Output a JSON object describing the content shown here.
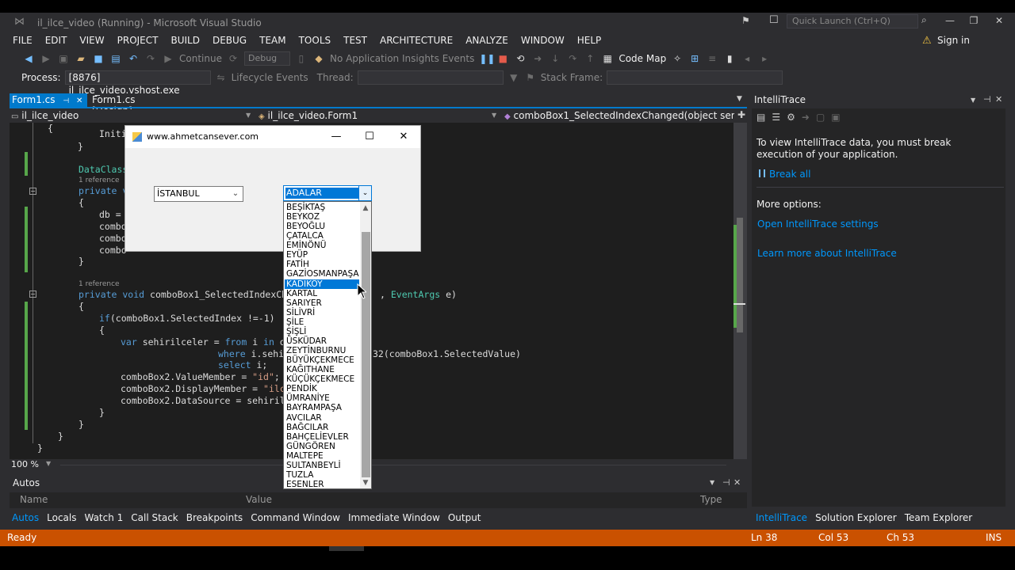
{
  "window": {
    "title": "il_ilce_video (Running) - Microsoft Visual Studio",
    "quick_launch_placeholder": "Quick Launch (Ctrl+Q)",
    "sign_in": "Sign in"
  },
  "menu": [
    "FILE",
    "EDIT",
    "VIEW",
    "PROJECT",
    "BUILD",
    "DEBUG",
    "TEAM",
    "TOOLS",
    "TEST",
    "ARCHITECTURE",
    "ANALYZE",
    "WINDOW",
    "HELP"
  ],
  "toolbar": {
    "continue": "Continue",
    "config": "Debug",
    "insights": "No Application Insights Events",
    "code_map": "Code Map"
  },
  "process_bar": {
    "process_label": "Process:",
    "process_value": "[8876] il_ilce_video.vshost.exe",
    "lifecycle": "Lifecycle Events",
    "thread_label": "Thread:",
    "stack_frame_label": "Stack Frame:"
  },
  "doc_tabs": {
    "active": "Form1.cs",
    "inactive": "Form1.cs [Design]"
  },
  "nav": {
    "project": "il_ilce_video",
    "class": "il_ilce_video.Form1",
    "member": "comboBox1_SelectedIndexChanged(object sender, Even"
  },
  "code": {
    "l1": "Initi",
    "l2": "}",
    "l3": "DataClass",
    "ref1": "1 reference",
    "l4_kw": "private v",
    "l5": "{",
    "l6": "db =",
    "l7": "combo",
    "l8": "combo",
    "l9": "combo",
    "l10": "}",
    "ref2": "1 reference",
    "l11_kw": "private void",
    "l11_rest": " comboBox1_SelectedIndexChar",
    "l11_tail_pre": ", ",
    "l11_tail_typ": "EventArgs",
    "l11_tail_post": " e)",
    "l12": "{",
    "l13_kw": "if",
    "l13_rest": "(comboBox1.SelectedIndex !=-1)",
    "l14": "{",
    "l15_kw": "var",
    "l15_mid": " sehirilceler = ",
    "l15_kw2": "from",
    "l15_mid2": " i ",
    "l15_kw3": "in",
    "l15_end": " db",
    "l16_kw": "where",
    "l16_mid": " i.sehi",
    "l16_end": "32(comboBox1.SelectedValue)",
    "l17_kw": "select",
    "l17_end": " i;",
    "l18_pre": "comboBox2.ValueMember = ",
    "l18_str": "\"id\"",
    "l18_end": ";",
    "l19_pre": "comboBox2.DisplayMember = ",
    "l19_str": "\"ilce\"",
    "l20": "comboBox2.DataSource = sehirilce",
    "l21": "}",
    "l22": "}",
    "l23": "}",
    "l24": "}"
  },
  "zoom": "100 %",
  "autos": {
    "title": "Autos",
    "col_name": "Name",
    "col_value": "Value",
    "col_type": "Type"
  },
  "bottom_tabs": [
    "Autos",
    "Locals",
    "Watch 1",
    "Call Stack",
    "Breakpoints",
    "Command Window",
    "Immediate Window",
    "Output"
  ],
  "intellitrace": {
    "title": "IntelliTrace",
    "message": "To view IntelliTrace data, you must break execution of your application.",
    "break_all": "Break all",
    "more_options": "More options:",
    "open_settings": "Open IntelliTrace settings",
    "learn_more": "Learn more about IntelliTrace"
  },
  "right_tabs": [
    "IntelliTrace",
    "Solution Explorer",
    "Team Explorer"
  ],
  "status": {
    "ready": "Ready",
    "ln": "Ln 38",
    "col": "Col 53",
    "ch": "Ch 53",
    "ins": "INS"
  },
  "winform": {
    "title": "www.ahmetcansever.com",
    "combo1_value": "İSTANBUL",
    "combo2_value": "ADALAR",
    "dropdown_items": [
      "BEŞİKTAŞ",
      "BEYKOZ",
      "BEYOĞLU",
      "ÇATALCA",
      "EMİNÖNÜ",
      "EYÜP",
      "FATİH",
      "GAZİOSMANPAŞA",
      "KADIKÖY",
      "KARTAL",
      "SARIYER",
      "SİLİVRİ",
      "ŞİLE",
      "ŞİŞLİ",
      "ÜSKÜDAR",
      "ZEYTİNBURNU",
      "BÜYÜKÇEKMECE",
      "KAĞITHANE",
      "KÜÇÜKÇEKMECE",
      "PENDİK",
      "ÜMRANİYE",
      "BAYRAMPAŞA",
      "AVCILAR",
      "BAĞCILAR",
      "BAHÇELİEVLER",
      "GÜNGÖREN",
      "MALTEPE",
      "SULTANBEYLİ",
      "TUZLA",
      "ESENLER"
    ],
    "selected_item": "KADIKÖY"
  },
  "colors": {
    "accent": "#007acc",
    "status": "#ca5100",
    "background": "#2d2d30",
    "editor": "#1e1e1e"
  }
}
